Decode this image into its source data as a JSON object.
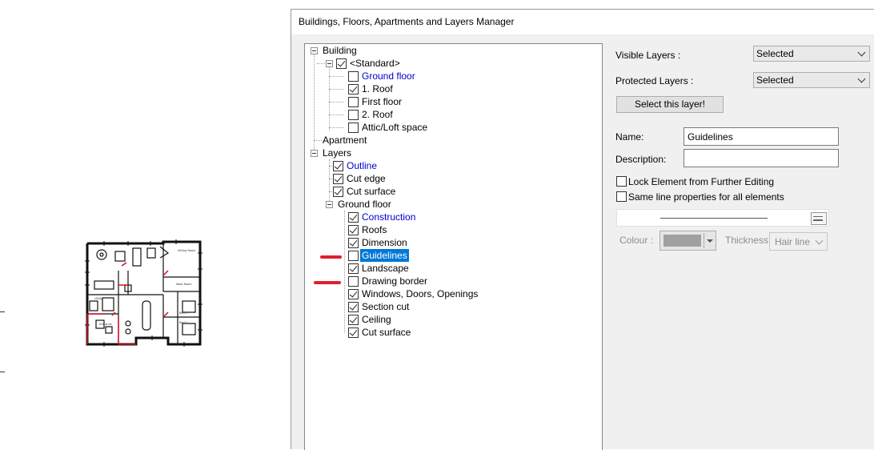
{
  "dialog": {
    "title": "Buildings, Floors, Apartments and Layers Manager"
  },
  "tree": {
    "nodes": [
      {
        "label": "Building",
        "checkbox": null,
        "blue": false
      },
      {
        "label": "<Standard>",
        "checkbox": true,
        "blue": false
      },
      {
        "label": "Ground floor",
        "checkbox": false,
        "blue": true
      },
      {
        "label": "1. Roof",
        "checkbox": true,
        "blue": false
      },
      {
        "label": "First floor",
        "checkbox": false,
        "blue": false
      },
      {
        "label": "2. Roof",
        "checkbox": false,
        "blue": false
      },
      {
        "label": "Attic/Loft space",
        "checkbox": false,
        "blue": false
      },
      {
        "label": "Apartment",
        "checkbox": null,
        "blue": false
      },
      {
        "label": "Layers",
        "checkbox": null,
        "blue": false
      },
      {
        "label": "Outline",
        "checkbox": true,
        "blue": true
      },
      {
        "label": "Cut edge",
        "checkbox": true,
        "blue": false
      },
      {
        "label": "Cut surface",
        "checkbox": true,
        "blue": false
      },
      {
        "label": "Ground floor",
        "checkbox": null,
        "blue": false
      },
      {
        "label": "Construction",
        "checkbox": true,
        "blue": true
      },
      {
        "label": "Roofs",
        "checkbox": true,
        "blue": false
      },
      {
        "label": "Dimension",
        "checkbox": true,
        "blue": false
      },
      {
        "label": "Guidelines",
        "checkbox": false,
        "blue": false,
        "selected": true
      },
      {
        "label": "Landscape",
        "checkbox": true,
        "blue": false
      },
      {
        "label": "Drawing border",
        "checkbox": false,
        "blue": false
      },
      {
        "label": "Windows, Doors, Openings",
        "checkbox": true,
        "blue": false
      },
      {
        "label": "Section cut",
        "checkbox": true,
        "blue": false
      },
      {
        "label": "Ceiling",
        "checkbox": true,
        "blue": false
      },
      {
        "label": "Cut surface",
        "checkbox": true,
        "blue": false
      }
    ]
  },
  "panel": {
    "visible_layers_label": "Visible Layers :",
    "visible_layers_value": "Selected",
    "protected_layers_label": "Protected Layers :",
    "protected_layers_value": "Selected",
    "select_layer_button": "Select this layer!",
    "name_label": "Name:",
    "name_value": "Guidelines",
    "description_label": "Description:",
    "description_value": "",
    "lock_label": "Lock Element from Further Editing",
    "same_line_label": "Same line properties for all elements",
    "colour_label": "Colour :",
    "thickness_label": "Thickness:",
    "thickness_value": "Hair line",
    "colour_swatch": "#a0a0a0"
  },
  "floorplan": {
    "room_labels": [
      "Sitting Room",
      "Wool Room",
      "Bed 1",
      "Bed 2",
      "Utility",
      "Entrance"
    ]
  }
}
